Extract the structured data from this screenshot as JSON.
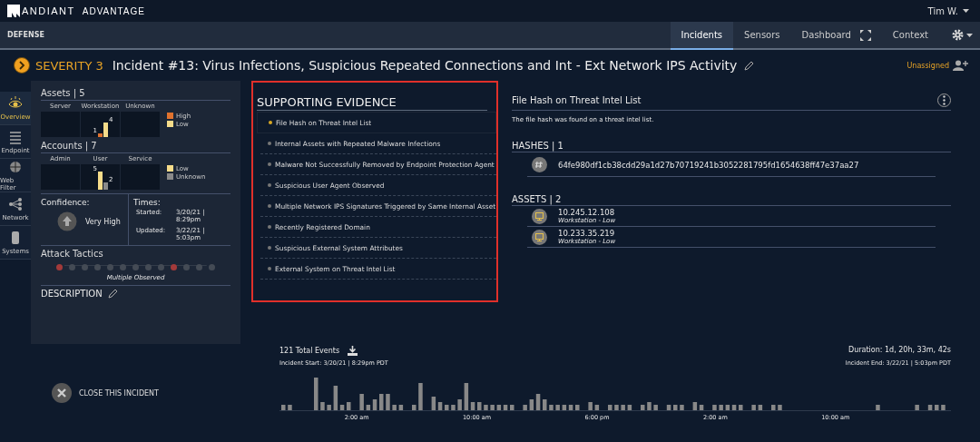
{
  "brand": {
    "name": "ANDIANT",
    "product": "ADVANTAGE"
  },
  "user": {
    "name": "Tim W."
  },
  "nav": {
    "section": "DEFENSE",
    "tabs": [
      {
        "label": "Incidents",
        "selected": true
      },
      {
        "label": "Sensors",
        "selected": false
      },
      {
        "label": "Dashboard",
        "selected": false
      },
      {
        "label": "Context",
        "selected": false
      }
    ]
  },
  "incident": {
    "severity": "SEVERITY 3",
    "title": "Incident #13: Virus Infections, Suspicious Repeated Connections and Int - Ext Network IPS Activity",
    "assignee": "Unassigned"
  },
  "sidebar": {
    "items": [
      {
        "label": "Overview",
        "selected": true
      },
      {
        "label": "Endpoint",
        "selected": false
      },
      {
        "label": "Web Filter",
        "selected": false
      },
      {
        "label": "Network",
        "selected": false
      },
      {
        "label": "Systems",
        "selected": false
      }
    ]
  },
  "assets": {
    "title": "Assets | 5",
    "chart_data": {
      "type": "bar",
      "legend": "right",
      "categories": [
        "Server",
        "Workstation",
        "Unknown"
      ],
      "data_labels": true,
      "series": [
        {
          "name": "High",
          "color": "#e0722e",
          "values": [
            null,
            1,
            null
          ]
        },
        {
          "name": "Low",
          "color": "#f6dc8a",
          "values": [
            null,
            4,
            null
          ]
        }
      ]
    }
  },
  "accounts": {
    "title": "Accounts | 7",
    "chart_data": {
      "type": "bar",
      "legend": "right",
      "categories": [
        "Admin",
        "User",
        "Service"
      ],
      "data_labels": true,
      "series": [
        {
          "name": "Low",
          "color": "#f6dc8a",
          "values": [
            null,
            5,
            null
          ]
        },
        {
          "name": "Unknown",
          "color": "#8a8a8a",
          "values": [
            null,
            2,
            null
          ]
        }
      ]
    }
  },
  "confidence": {
    "label": "Confidence:",
    "value": "Very High"
  },
  "times": {
    "label": "Times:",
    "started_label": "Started:",
    "started": "3/20/21 | 8:29pm",
    "updated_label": "Updated:",
    "updated": "3/22/21 | 5:03pm"
  },
  "attack_tactics": {
    "title": "Attack Tactics",
    "caption": "Multiple Observed",
    "tactics": [
      {
        "observed": true
      },
      {
        "observed": false
      },
      {
        "observed": false
      },
      {
        "observed": false
      },
      {
        "observed": false
      },
      {
        "observed": false
      },
      {
        "observed": false
      },
      {
        "observed": false
      },
      {
        "observed": false
      },
      {
        "observed": true
      },
      {
        "observed": false
      },
      {
        "observed": false
      },
      {
        "observed": false
      }
    ]
  },
  "description": {
    "title": "DESCRIPTION"
  },
  "evidence": {
    "title": "SUPPORTING EVIDENCE",
    "items": [
      {
        "label": "File Hash on Threat Intel List",
        "selected": true
      },
      {
        "label": "Internal Assets with Repeated Malware Infections",
        "selected": false
      },
      {
        "label": "Malware Not Successfully Removed by Endpoint Protection Agent",
        "selected": false
      },
      {
        "label": "Suspicious User Agent Observed",
        "selected": false
      },
      {
        "label": "Multiple Network IPS Signatures Triggered by Same Internal Asset",
        "selected": false
      },
      {
        "label": "Recently Registered Domain",
        "selected": false
      },
      {
        "label": "Suspicious External System Attributes",
        "selected": false
      },
      {
        "label": "External System on Threat Intel List",
        "selected": false
      }
    ]
  },
  "detail": {
    "title": "File Hash on Threat Intel List",
    "description": "The file hash was found on a threat intel list.",
    "hashes": {
      "title": "HASHES | 1",
      "items": [
        "64fe980df1cb38cdd29a1d27b70719241b3052281795fd1654638ff47e37aa27"
      ]
    },
    "assets": {
      "title": "ASSETS | 2",
      "items": [
        {
          "ip": "10.245.12.108",
          "type": "Workstation - Low"
        },
        {
          "ip": "10.233.35.219",
          "type": "Workstation - Low"
        }
      ]
    }
  },
  "close_button": {
    "label": "CLOSE THIS INCIDENT"
  },
  "timeline": {
    "total": "121 Total Events",
    "start": "Incident Start: 3/20/21 | 8:29pm PDT",
    "duration": "Duration: 1d, 20h, 33m, 42s",
    "end": "Incident End: 3/22/21 | 5:03pm PDT",
    "axis_labels": [
      "2:00 am",
      "10:00 am",
      "6:00 pm",
      "2:00 am",
      "10:00 am"
    ]
  }
}
